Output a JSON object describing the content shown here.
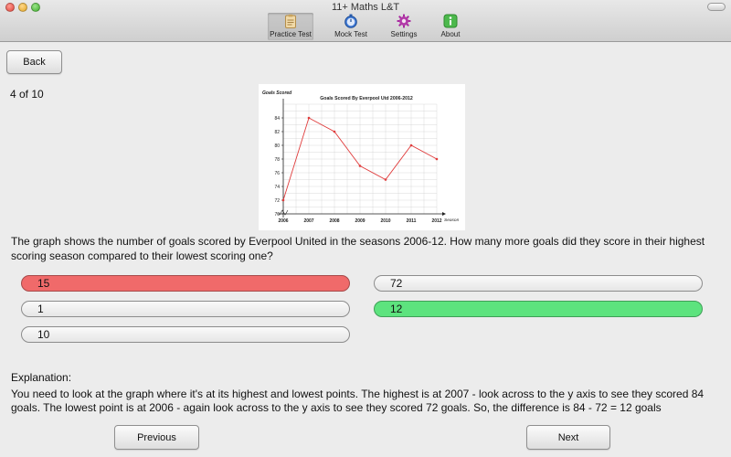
{
  "window": {
    "title": "11+ Maths L&T"
  },
  "toolbar": {
    "items": [
      {
        "label": "Practice Test",
        "icon": "clipboard-icon"
      },
      {
        "label": "Mock Test",
        "icon": "stopwatch-icon"
      },
      {
        "label": "Settings",
        "icon": "gear-icon"
      },
      {
        "label": "About",
        "icon": "info-icon"
      }
    ],
    "selected": "Practice Test"
  },
  "nav": {
    "back_label": "Back",
    "previous_label": "Previous",
    "next_label": "Next"
  },
  "progress": {
    "text": "4 of 10"
  },
  "question": {
    "text": "The graph shows the number of goals scored by Everpool United in the seasons 2006-12. How many more goals did they score in their highest scoring season compared to their lowest scoring one?"
  },
  "answers": [
    {
      "value": "15",
      "state": "wrong"
    },
    {
      "value": "72",
      "state": "neutral"
    },
    {
      "value": "1",
      "state": "neutral"
    },
    {
      "value": "12",
      "state": "correct"
    },
    {
      "value": "10",
      "state": "neutral"
    }
  ],
  "explanation": {
    "heading": "Explanation:",
    "text": "You need to look at the graph where it's at its highest and lowest points. The highest is at 2007 - look across to the y axis to see they scored 84 goals. The lowest point is at 2006 - again look across to the y axis to see they scored 72 goals. So, the difference is 84 - 72 = 12 goals"
  },
  "colors": {
    "wrong": "#f06a6a",
    "correct": "#5de37e",
    "line": "#e03c3c"
  },
  "chart_data": {
    "type": "line",
    "title": "Goals Scored By Everpool Utd 2006-2012",
    "xlabel": "Season",
    "ylabel": "Goals Scored",
    "x": [
      "2006",
      "2007",
      "2008",
      "2009",
      "2010",
      "2011",
      "2012"
    ],
    "y": [
      72,
      84,
      82,
      77,
      75,
      80,
      78
    ],
    "ylim": [
      70,
      86
    ],
    "yticks": [
      70,
      72,
      74,
      76,
      78,
      80,
      82,
      84
    ],
    "grid": true,
    "axis_break": true
  }
}
